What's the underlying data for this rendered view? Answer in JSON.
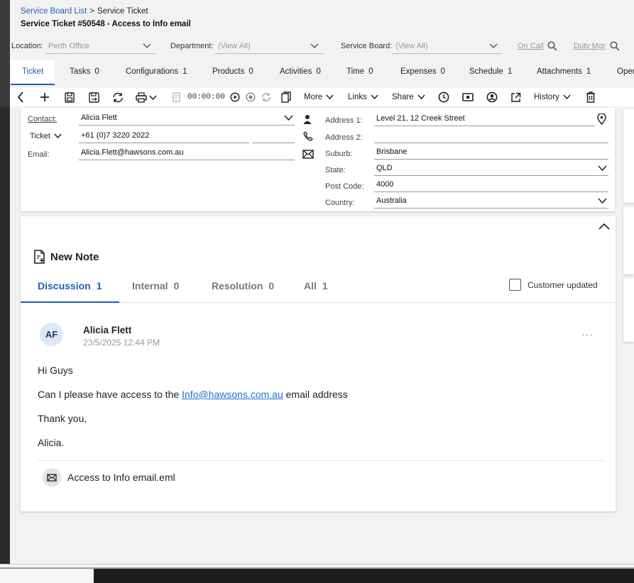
{
  "header": {
    "breadcrumb": [
      "Service Board List",
      "Service Ticket"
    ],
    "breadcrumb_sep": ">",
    "title": "Service Ticket #50548 - Access to Info email"
  },
  "filters": {
    "location_label": "Location:",
    "location_value": "Perth Office",
    "department_label": "Department:",
    "department_value": "(View All)",
    "service_board_label": "Service Board:",
    "service_board_value": "(View All)",
    "on_call": "On Call",
    "duty_mgr": "Duty Mgr"
  },
  "tabs": [
    {
      "label": "Ticket",
      "count": ""
    },
    {
      "label": "Tasks",
      "count": "0"
    },
    {
      "label": "Configurations",
      "count": "1"
    },
    {
      "label": "Products",
      "count": "0"
    },
    {
      "label": "Activities",
      "count": "0"
    },
    {
      "label": "Time",
      "count": "0"
    },
    {
      "label": "Expenses",
      "count": "0"
    },
    {
      "label": "Schedule",
      "count": "1"
    },
    {
      "label": "Attachments",
      "count": "1"
    },
    {
      "label": "Oper",
      "count": ""
    }
  ],
  "toolbar": {
    "timer": "00:00:00",
    "more": "More",
    "links": "Links",
    "share": "Share",
    "history": "History"
  },
  "contact": {
    "contact_label": "Contact:",
    "contact_value": "Alicia Flett",
    "ticket_dropdown": "Ticket",
    "phone_value": "+61 (0)7 3220 2022",
    "email_label": "Email:",
    "email_value": "Alicia.Flett@hawsons.com.au",
    "address1_label": "Address 1:",
    "address1_value": "Level 21, 12 Creek Street",
    "address2_label": "Address 2:",
    "address2_value": "",
    "suburb_label": "Suburb:",
    "suburb_value": "Brisbane",
    "state_label": "State:",
    "state_value": "QLD",
    "postcode_label": "Post Code:",
    "postcode_value": "4000",
    "country_label": "Country:",
    "country_value": "Australia"
  },
  "notes": {
    "new_note": "New Note",
    "tabs": [
      {
        "label": "Discussion",
        "count": "1"
      },
      {
        "label": "Internal",
        "count": "0"
      },
      {
        "label": "Resolution",
        "count": "0"
      },
      {
        "label": "All",
        "count": "1"
      }
    ],
    "customer_updated": "Customer updated",
    "entry": {
      "initials": "AF",
      "author": "Alicia Flett",
      "timestamp": "23/5/2025 12:44 PM",
      "more": "···",
      "line1": "Hi Guys",
      "line2_pre": "Can I please have access to the ",
      "line2_link": "Info@hawsons.com.au",
      "line2_post": " email address",
      "line3": "Thank you,",
      "line4": "Alicia.",
      "attachment": "Access to Info email.eml"
    }
  },
  "colors": {
    "accent": "#1f5fb4",
    "link": "#1f6fd0",
    "avatar_bg": "#dde8f5"
  }
}
